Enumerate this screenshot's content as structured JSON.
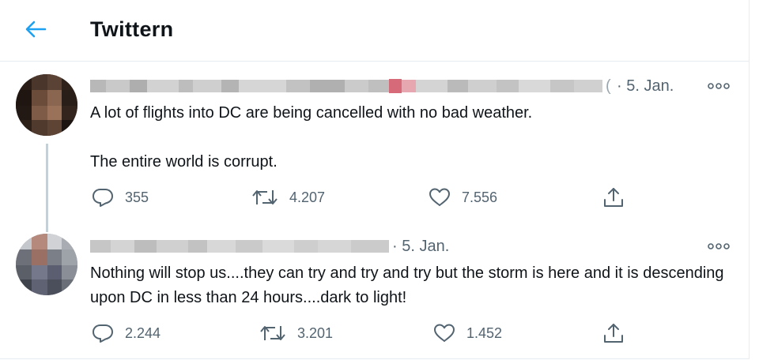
{
  "header": {
    "title": "Twittern",
    "back_icon": "arrow-left-icon",
    "accent": "#1da1f2"
  },
  "tweets": [
    {
      "date": "· 5. Jan.",
      "handle_fragment": "(",
      "text": "A lot of flights into DC are being cancelled with no bad weather.\n\nThe entire world is corrupt.",
      "replies": "355",
      "retweets": "4.207",
      "likes": "7.556"
    },
    {
      "date": "· 5. Jan.",
      "text": "Nothing will stop us....they can try and try and try but the storm is here and it is descending upon DC in less than 24 hours....dark to light!",
      "replies": "2.244",
      "retweets": "3.201",
      "likes": "1.452"
    }
  ],
  "icons": {
    "reply": "reply-icon",
    "retweet": "retweet-icon",
    "like": "heart-icon",
    "share": "share-icon",
    "more": "more-icon"
  }
}
